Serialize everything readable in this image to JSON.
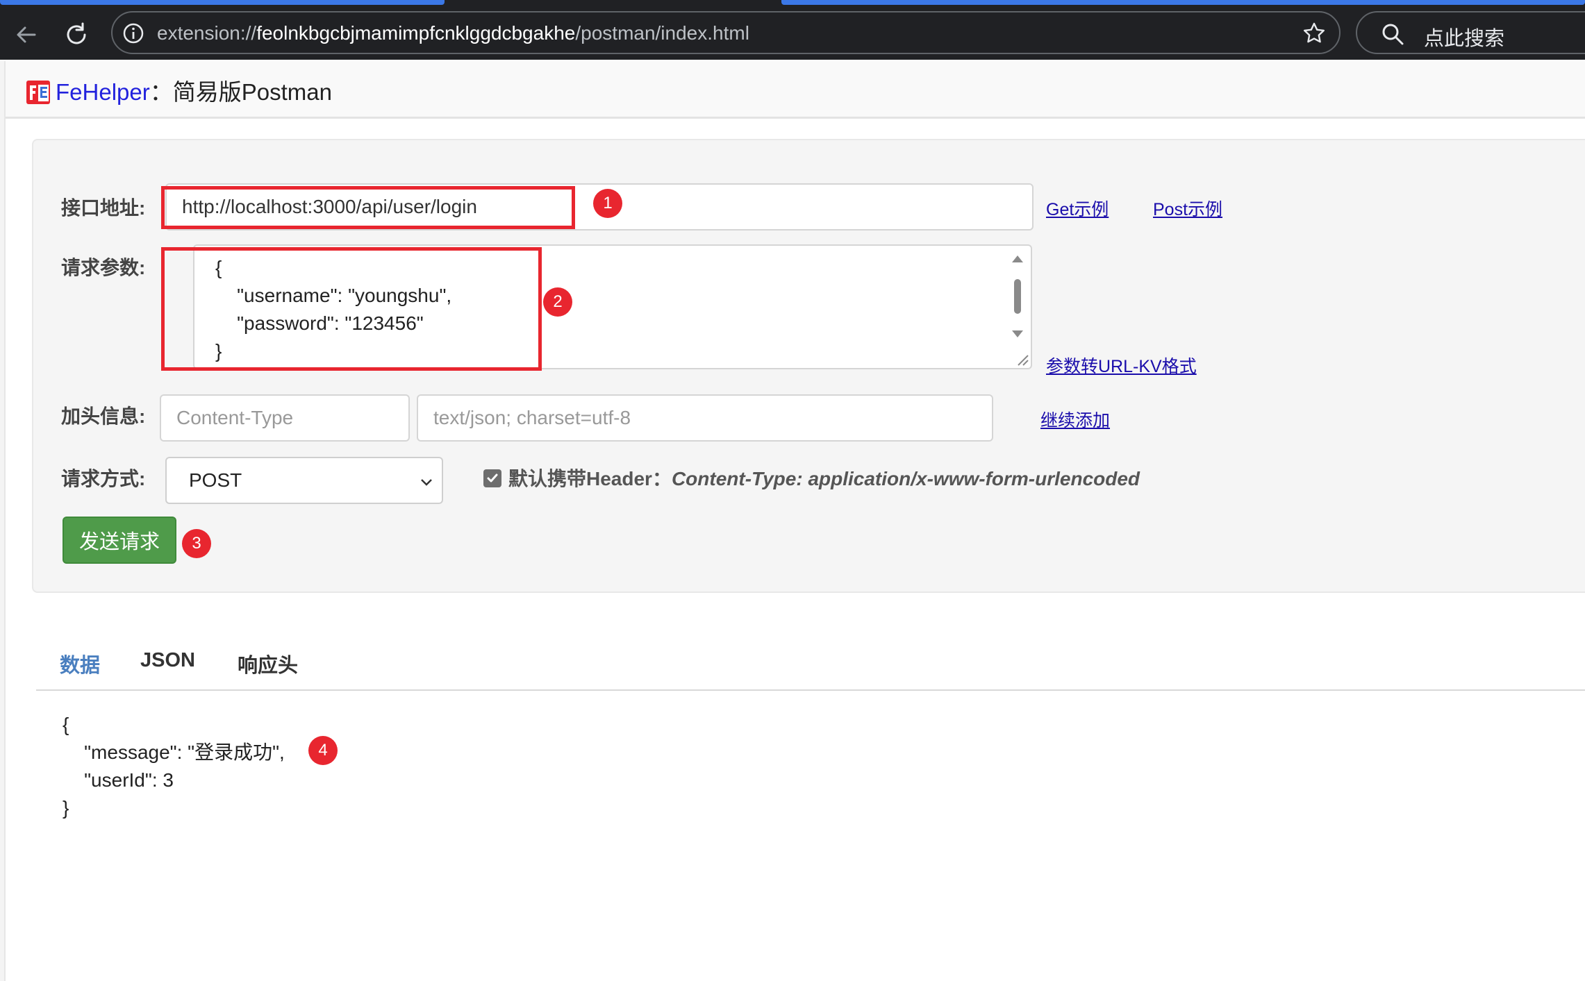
{
  "browser": {
    "url_prefix": "extension://",
    "url_host": "feolnkbgcbjmamimpfcnklggdcbgakhe",
    "url_path": "/postman/index.html",
    "search_placeholder": "点此搜索"
  },
  "header": {
    "brand": "FeHelper",
    "title": "：简易版Postman"
  },
  "form": {
    "url_label": "接口地址:",
    "url_value": "http://localhost:3000/api/user/login",
    "params_label": "请求参数:",
    "params_lines": [
      "{",
      "    \"username\": \"youngshu\",",
      "    \"password\": \"123456\"",
      "}"
    ],
    "headers_label": "加头信息:",
    "header_key_placeholder": "Content-Type",
    "header_value_placeholder": "text/json; charset=utf-8",
    "method_label": "请求方式:",
    "method_value": "POST",
    "default_header_label": "默认携带Header：",
    "default_header_value": "Content-Type: application/x-www-form-urlencoded",
    "default_header_checked": true,
    "send_label": "发送请求"
  },
  "links": {
    "get_example": "Get示例",
    "post_example": "Post示例",
    "to_url_kv": "参数转URL-KV格式",
    "add_more": "继续添加"
  },
  "annotations": [
    "1",
    "2",
    "3",
    "4"
  ],
  "tabs": [
    "数据",
    "JSON",
    "响应头"
  ],
  "active_tab": "数据",
  "response_lines": [
    "{",
    "    \"message\": \"登录成功\",",
    "    \"userId\": 3",
    "}"
  ],
  "colors": {
    "annotation_red": "#e8262f",
    "send_green": "#4f9b4a",
    "brand_blue": "#2222dd",
    "active_tab": "#4a7fbf"
  }
}
